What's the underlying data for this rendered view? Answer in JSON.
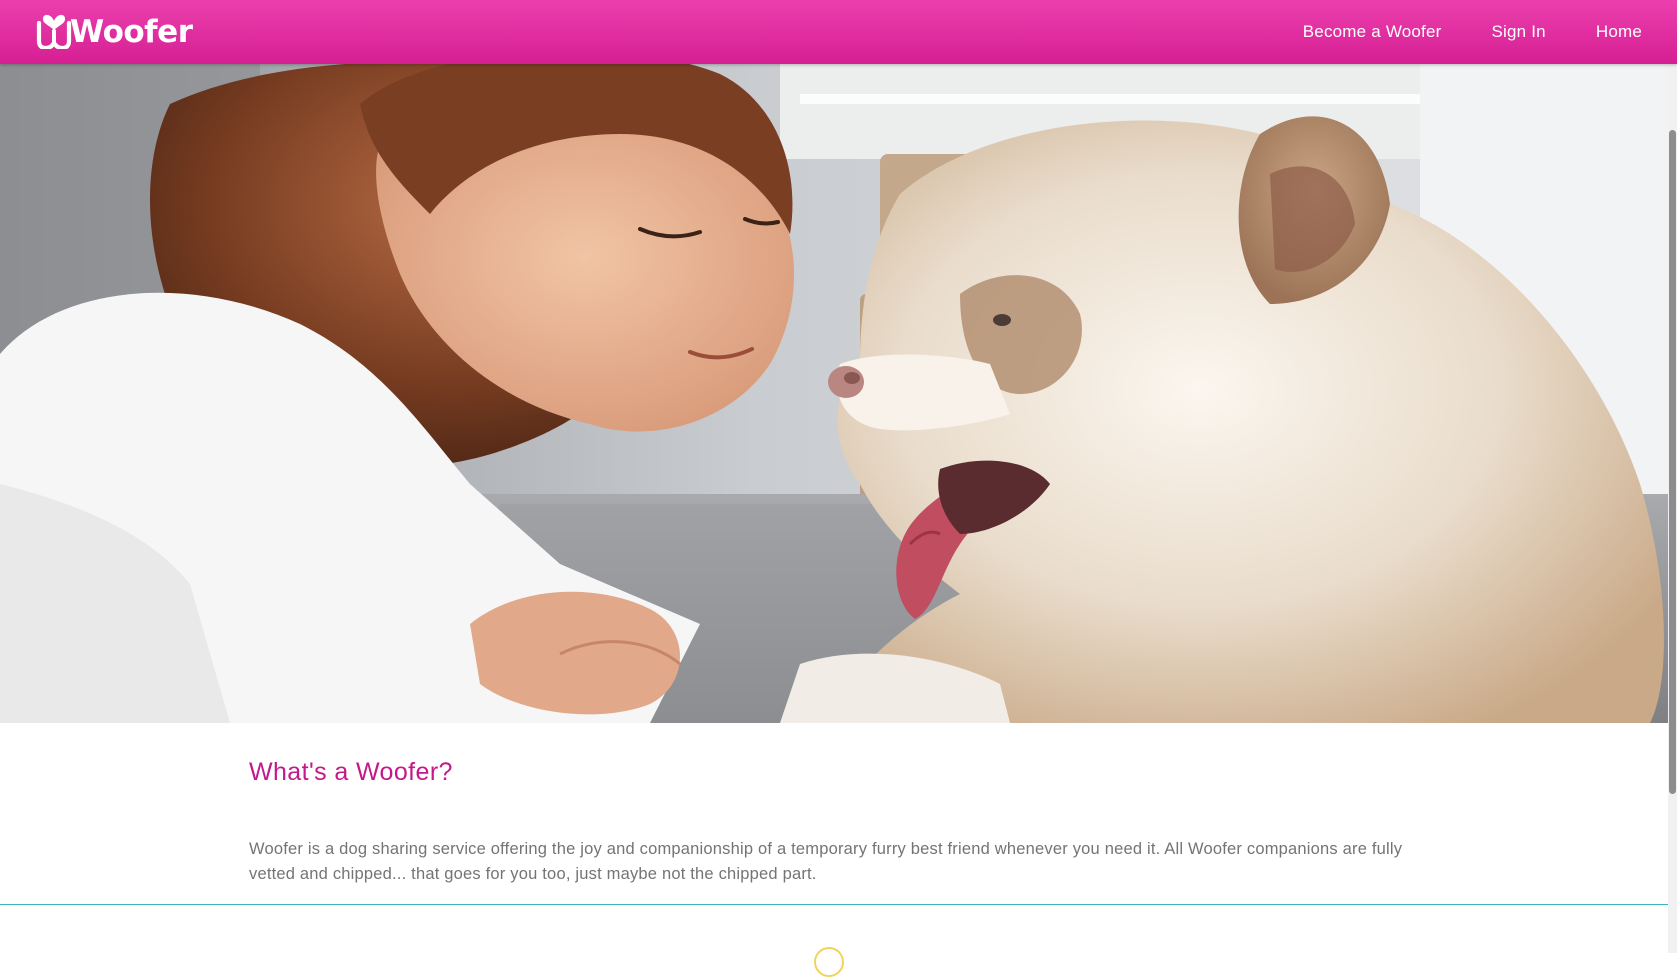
{
  "brand": {
    "name": "Woofer",
    "color": "#d51f93",
    "logo_icon": "heart-bone-w-logo-icon"
  },
  "nav": {
    "become_label": "Become a Woofer",
    "signin_label": "Sign In",
    "home_label": "Home"
  },
  "hero": {
    "image": "woman-smiling-at-husky-puppy-photo"
  },
  "about": {
    "title": "What's a Woofer?",
    "body": "Woofer is a dog sharing service offering the joy and companionship of a temporary furry best friend whenever you need it. All Woofer companions are fully vetted and chipped... that goes for you too, just maybe not the chipped part."
  },
  "colors": {
    "accent": "#c3198a",
    "divider": "#3cb6b8",
    "highlight": "#f2d35a",
    "body_text": "#747474"
  }
}
